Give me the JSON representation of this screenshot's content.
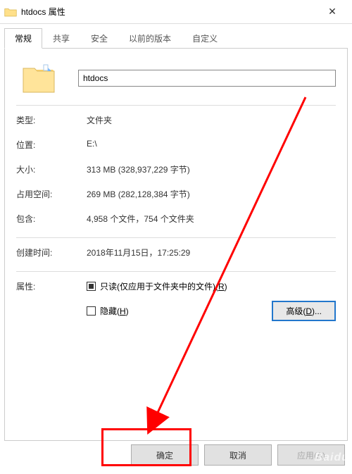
{
  "titlebar": {
    "title": "htdocs 属性",
    "close_glyph": "✕"
  },
  "tabs": [
    {
      "label": "常规"
    },
    {
      "label": "共享"
    },
    {
      "label": "安全"
    },
    {
      "label": "以前的版本"
    },
    {
      "label": "自定义"
    }
  ],
  "folder_name": "htdocs",
  "rows": {
    "type_label": "类型:",
    "type_value": "文件夹",
    "location_label": "位置:",
    "location_value": "E:\\",
    "size_label": "大小:",
    "size_value": "313 MB (328,937,229 字节)",
    "size_on_disk_label": "占用空间:",
    "size_on_disk_value": "269 MB (282,128,384 字节)",
    "contains_label": "包含:",
    "contains_value": "4,958 个文件，754 个文件夹",
    "created_label": "创建时间:",
    "created_value": "2018年11月15日，17:25:29",
    "attr_label": "属性:"
  },
  "checkboxes": {
    "readonly_prefix": "只读(仅应用于文件夹中的文件)(",
    "readonly_key": "R",
    "readonly_suffix": ")",
    "hidden_prefix": "隐藏(",
    "hidden_key": "H",
    "hidden_suffix": ")"
  },
  "advanced_button_prefix": "高级(",
  "advanced_button_key": "D",
  "advanced_button_suffix": ")...",
  "buttons": {
    "ok": "确定",
    "cancel": "取消",
    "apply": "应用(A)"
  },
  "watermark": "Baidu"
}
